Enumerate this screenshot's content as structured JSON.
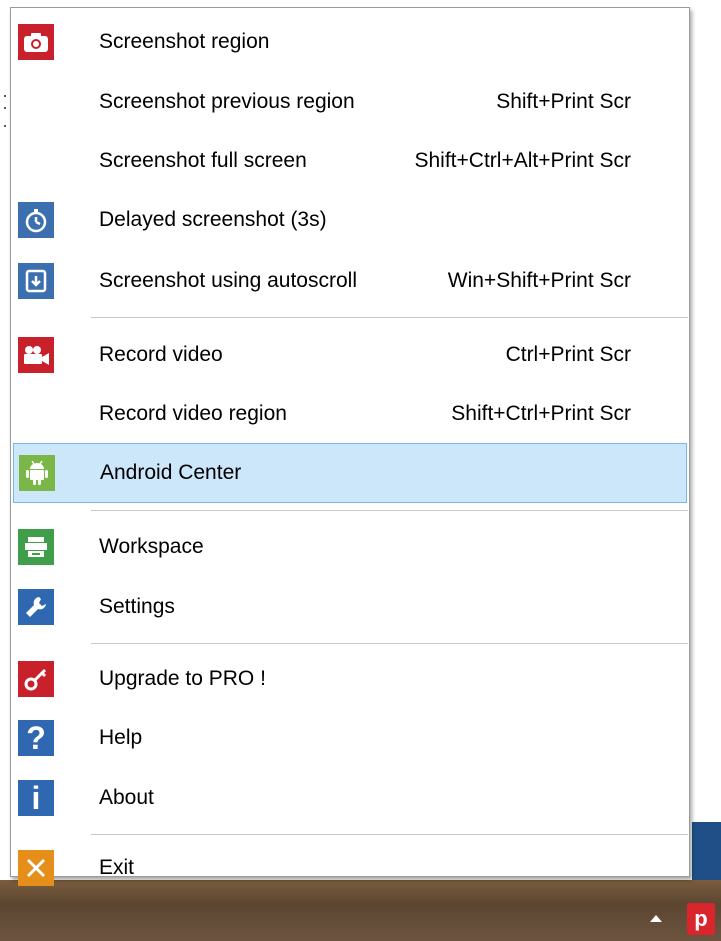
{
  "menu": {
    "items": [
      {
        "label": "Screenshot region",
        "shortcut": "",
        "icon": "camera-icon",
        "color": "#c9212b"
      },
      {
        "label": "Screenshot previous region",
        "shortcut": "Shift+Print Scr",
        "icon": "",
        "color": ""
      },
      {
        "label": "Screenshot full screen",
        "shortcut": "Shift+Ctrl+Alt+Print Scr",
        "icon": "",
        "color": ""
      },
      {
        "label": "Delayed screenshot (3s)",
        "shortcut": "",
        "icon": "timer-icon",
        "color": "#3b6fb0"
      },
      {
        "label": "Screenshot using autoscroll",
        "shortcut": "Win+Shift+Print Scr",
        "icon": "autoscroll-icon",
        "color": "#3b6fb0"
      },
      {
        "label": "Record video",
        "shortcut": "Ctrl+Print Scr",
        "icon": "video-camera-icon",
        "color": "#c9212b"
      },
      {
        "label": "Record video region",
        "shortcut": "Shift+Ctrl+Print Scr",
        "icon": "",
        "color": ""
      },
      {
        "label": "Android Center",
        "shortcut": "",
        "icon": "android-icon",
        "color": "#7ab648"
      },
      {
        "label": "Workspace",
        "shortcut": "",
        "icon": "workspace-icon",
        "color": "#3f9e4a"
      },
      {
        "label": "Settings",
        "shortcut": "",
        "icon": "wrench-icon",
        "color": "#2f68b1"
      },
      {
        "label": "Upgrade to PRO !",
        "shortcut": "",
        "icon": "key-icon",
        "color": "#c9212b"
      },
      {
        "label": "Help",
        "shortcut": "",
        "icon": "question-icon",
        "color": "#2f68b1"
      },
      {
        "label": "About",
        "shortcut": "",
        "icon": "info-icon",
        "color": "#2f68b1"
      },
      {
        "label": "Exit",
        "shortcut": "",
        "icon": "close-icon",
        "color": "#e58e1a"
      }
    ],
    "highlighted_item": "Android Center"
  },
  "taskbar": {
    "tray_app_letter": "p",
    "tray_overflow_icon": "chevron-up-icon",
    "tray_app_color": "#d8262c"
  }
}
